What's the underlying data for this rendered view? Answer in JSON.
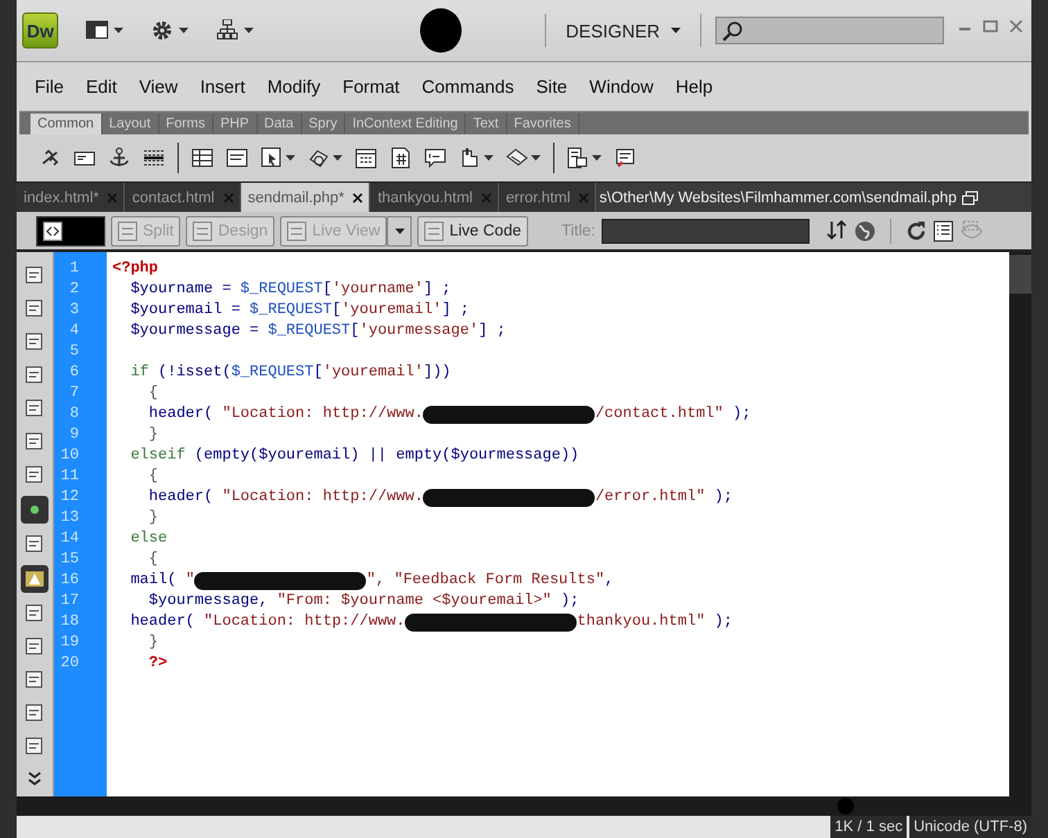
{
  "title_bar": {
    "app_badge": "Dw",
    "workspace": "DESIGNER"
  },
  "menu": [
    "File",
    "Edit",
    "View",
    "Insert",
    "Modify",
    "Format",
    "Commands",
    "Site",
    "Window",
    "Help"
  ],
  "insert_panel": {
    "tabs": [
      {
        "label": "Common",
        "selected": true
      },
      {
        "label": "Layout",
        "selected": false
      },
      {
        "label": "Forms",
        "selected": false
      },
      {
        "label": "PHP",
        "selected": false
      },
      {
        "label": "Data",
        "selected": false
      },
      {
        "label": "Spry",
        "selected": false
      },
      {
        "label": "InContext Editing",
        "selected": false
      },
      {
        "label": "Text",
        "selected": false
      },
      {
        "label": "Favorites",
        "selected": false
      }
    ]
  },
  "document_tabs": [
    {
      "label": "index.html*",
      "selected": false
    },
    {
      "label": "contact.html",
      "selected": false
    },
    {
      "label": "sendmail.php*",
      "selected": true
    },
    {
      "label": "thankyou.html",
      "selected": false
    },
    {
      "label": "error.html",
      "selected": false
    }
  ],
  "file_path": "s\\Other\\My Websites\\Filmhammer.com\\sendmail.php",
  "view_buttons": [
    {
      "label": "Split",
      "selected": false,
      "disabled": true
    },
    {
      "label": "Design",
      "selected": false,
      "disabled": true
    },
    {
      "label": "Live View",
      "selected": false,
      "disabled": true
    },
    {
      "label": "Live Code",
      "selected": false,
      "disabled": false
    }
  ],
  "title_label": "Title:",
  "code_lines": [
    {
      "number": "1",
      "segments": [
        {
          "kind": "tag",
          "text": "<?php"
        }
      ]
    },
    {
      "number": "2",
      "segments": [
        {
          "kind": "var",
          "text": "  $yourname = "
        },
        {
          "kind": "super",
          "text": "$_REQUEST"
        },
        {
          "kind": "var",
          "text": "["
        },
        {
          "kind": "str",
          "text": "'yourname'"
        },
        {
          "kind": "var",
          "text": "] ;"
        }
      ]
    },
    {
      "number": "3",
      "segments": [
        {
          "kind": "var",
          "text": "  $youremail = "
        },
        {
          "kind": "super",
          "text": "$_REQUEST"
        },
        {
          "kind": "var",
          "text": "["
        },
        {
          "kind": "str",
          "text": "'youremail'"
        },
        {
          "kind": "var",
          "text": "] ;"
        }
      ]
    },
    {
      "number": "4",
      "segments": [
        {
          "kind": "var",
          "text": "  $yourmessage = "
        },
        {
          "kind": "super",
          "text": "$_REQUEST"
        },
        {
          "kind": "var",
          "text": "["
        },
        {
          "kind": "str",
          "text": "'yourmessage'"
        },
        {
          "kind": "var",
          "text": "] ;"
        }
      ]
    },
    {
      "number": "5"
    },
    {
      "number": "6",
      "segments": [
        {
          "kind": "kw",
          "text": "  if"
        },
        {
          "kind": "var",
          "text": " (!isset("
        },
        {
          "kind": "super",
          "text": "$_REQUEST"
        },
        {
          "kind": "var",
          "text": "["
        },
        {
          "kind": "str",
          "text": "'youremail'"
        },
        {
          "kind": "var",
          "text": "]))"
        }
      ]
    },
    {
      "number": "7",
      "segments": [
        {
          "kind": "punct",
          "text": "    {"
        }
      ]
    },
    {
      "number": "8",
      "segments": [
        {
          "kind": "var",
          "text": "    header("
        },
        {
          "kind": "str",
          "text": " \"Location: http://www."
        },
        {
          "kind": "redacted"
        },
        {
          "kind": "str",
          "text": "/contact.html\""
        },
        {
          "kind": "var",
          "text": " );"
        }
      ]
    },
    {
      "number": "9",
      "segments": [
        {
          "kind": "punct",
          "text": "    }"
        }
      ]
    },
    {
      "number": "10",
      "segments": [
        {
          "kind": "kw",
          "text": "  elseif"
        },
        {
          "kind": "var",
          "text": " (empty($youremail) || empty($yourmessage))"
        }
      ]
    },
    {
      "number": "11",
      "segments": [
        {
          "kind": "punct",
          "text": "    {"
        }
      ]
    },
    {
      "number": "12",
      "segments": [
        {
          "kind": "var",
          "text": "    header("
        },
        {
          "kind": "str",
          "text": " \"Location: http://www."
        },
        {
          "kind": "redacted"
        },
        {
          "kind": "str",
          "text": "/error.html\""
        },
        {
          "kind": "var",
          "text": " );"
        }
      ]
    },
    {
      "number": "13",
      "segments": [
        {
          "kind": "punct",
          "text": "    }"
        }
      ]
    },
    {
      "number": "14",
      "segments": [
        {
          "kind": "kw",
          "text": "  else"
        }
      ]
    },
    {
      "number": "15",
      "segments": [
        {
          "kind": "punct",
          "text": "    {"
        }
      ]
    },
    {
      "number": "16",
      "segments": [
        {
          "kind": "var",
          "text": "  mail("
        },
        {
          "kind": "str",
          "text": " \""
        },
        {
          "kind": "redacted"
        },
        {
          "kind": "str",
          "text": "\", \"Feedback Form Results\""
        },
        {
          "kind": "var",
          "text": ","
        }
      ]
    },
    {
      "number": "17",
      "segments": [
        {
          "kind": "var",
          "text": "    $yourmessage, "
        },
        {
          "kind": "str",
          "text": "\"From: $yourname <$youremail>\""
        },
        {
          "kind": "var",
          "text": " );"
        }
      ]
    },
    {
      "number": "18",
      "segments": [
        {
          "kind": "var",
          "text": "  header("
        },
        {
          "kind": "str",
          "text": " \"Location: http://www."
        },
        {
          "kind": "redacted"
        },
        {
          "kind": "str",
          "text": "thankyou.html\""
        },
        {
          "kind": "var",
          "text": " );"
        }
      ]
    },
    {
      "number": "19",
      "segments": [
        {
          "kind": "punct",
          "text": "    }"
        }
      ]
    },
    {
      "number": "20",
      "segments": [
        {
          "kind": "tag",
          "text": "    ?>"
        }
      ]
    }
  ],
  "status_bar": {
    "download": "1K / 1 sec",
    "encoding": "Unicode (UTF-8)"
  }
}
